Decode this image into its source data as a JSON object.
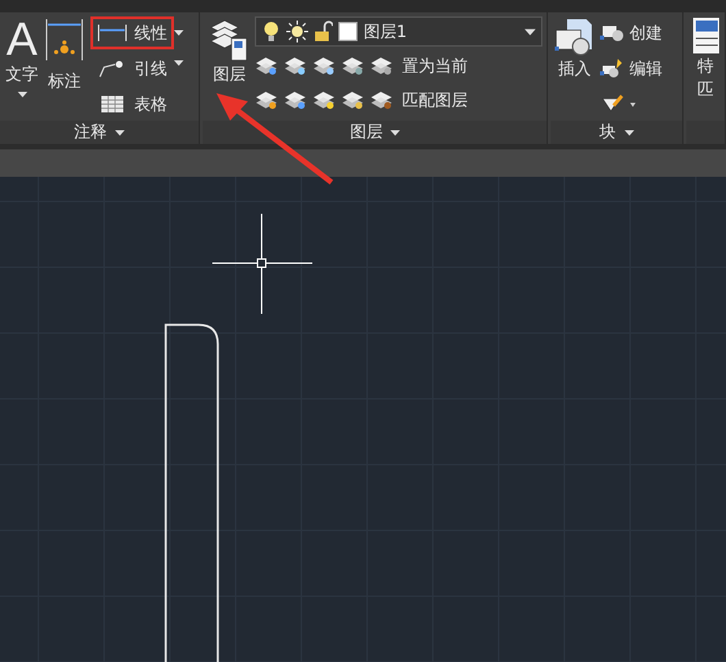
{
  "ribbon": {
    "annotation": {
      "title": "注释",
      "text_tool": {
        "glyph": "A",
        "label": "文字"
      },
      "dimension_tool": "标注",
      "linear": {
        "label": "线性",
        "highlighted": true
      },
      "leader": "引线",
      "table": "表格"
    },
    "layers": {
      "title": "图层",
      "properties": [
        "图层"
      ],
      "layer_dropdown": {
        "value": "图层1"
      },
      "actions": [
        "置为当前",
        "匹配图层"
      ]
    },
    "block": {
      "title": "块",
      "insert": "插入",
      "create": "创建",
      "edit": "编辑"
    },
    "cut_panel": {
      "labels": [
        "特",
        "匹"
      ]
    }
  }
}
